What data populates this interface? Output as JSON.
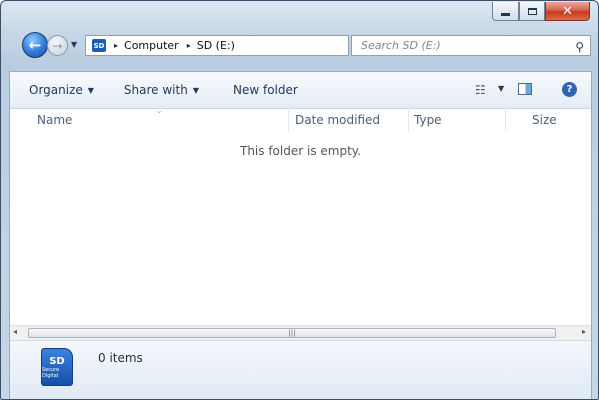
{
  "window": {
    "minimize_glyph": "",
    "maximize_glyph": "",
    "close_glyph": "✕"
  },
  "navigation": {
    "back_glyph": "←",
    "forward_glyph": "→",
    "history_glyph": "▼"
  },
  "address_bar": {
    "drive_badge": "SD",
    "crumbs": [
      "Computer",
      "SD (E:)"
    ],
    "separator": "▸",
    "dropdown_glyph": "▼",
    "refresh_glyph": "↻"
  },
  "search": {
    "placeholder": "Search SD (E:)",
    "icon_glyph": "⚲"
  },
  "toolbar": {
    "organize": "Organize",
    "share_with": "Share with",
    "new_folder": "New folder",
    "caret": "▼",
    "view_glyph": "☷",
    "help_glyph": "?"
  },
  "columns": [
    "Name",
    "Date modified",
    "Type",
    "Size"
  ],
  "empty_message": "This folder is empty.",
  "scrollbar": {
    "left_glyph": "◂",
    "right_glyph": "▸",
    "grip": "|||"
  },
  "status": {
    "drive_icon_text": "SD",
    "drive_icon_subtext": "Secure Digital",
    "item_count": "0 items"
  },
  "colors": {
    "accent": "#2f7ad6",
    "close_button": "#c43b20",
    "link_text": "#1e395b"
  }
}
